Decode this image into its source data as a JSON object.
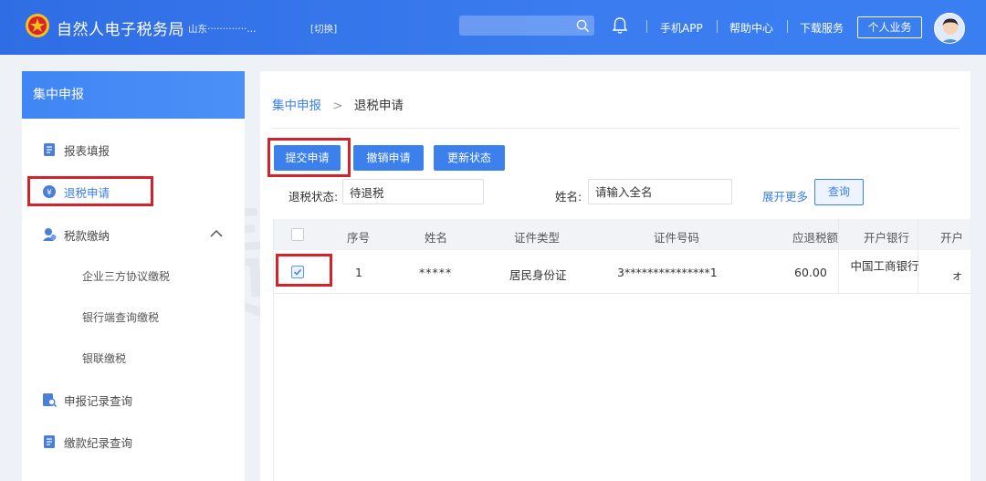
{
  "header": {
    "title": "自然人电子税务局",
    "region": "山东·············...",
    "switch_label": "[切换]",
    "search_placeholder": "",
    "links": [
      "手机APP",
      "帮助中心",
      "下载服务"
    ],
    "personal_button": "个人业务"
  },
  "sidebar": {
    "title": "集中申报",
    "items": [
      {
        "label": "报表填报",
        "icon": "report-icon"
      },
      {
        "label": "退税申请",
        "icon": "refund-icon",
        "highlighted": true
      },
      {
        "label": "税款缴纳",
        "icon": "payment-icon",
        "expanded": true
      },
      {
        "label": "申报记录查询",
        "icon": "record-search-icon"
      },
      {
        "label": "缴款纪录查询",
        "icon": "payment-record-icon"
      }
    ],
    "subitems": [
      "企业三方协议缴税",
      "银行端查询缴税",
      "银联缴税"
    ]
  },
  "breadcrumb": {
    "parent": "集中申报",
    "current": "退税申请"
  },
  "toolbar": {
    "submit": "提交申请",
    "cancel": "撤销申请",
    "refresh": "更新状态"
  },
  "filters": {
    "status_label": "退税状态:",
    "status_value": "待退税",
    "name_label": "姓名:",
    "name_placeholder": "请输入全名",
    "more_link": "展开更多",
    "query_button": "查询"
  },
  "table": {
    "columns": [
      "序号",
      "姓名",
      "证件类型",
      "证件号码",
      "应退税额",
      "开户银行",
      "开户"
    ],
    "rows": [
      {
        "checked": true,
        "index": "1",
        "name": "*****",
        "id_type": "居民身份证",
        "id_number": "3***************1",
        "refund": "60.00",
        "bank": "中国工商银行",
        "bank_extra": "ォ"
      }
    ]
  },
  "watermark": "债峰税苑",
  "colors": {
    "primary": "#3c80ee",
    "highlight": "#d2232a",
    "header": "#2f6de4"
  }
}
